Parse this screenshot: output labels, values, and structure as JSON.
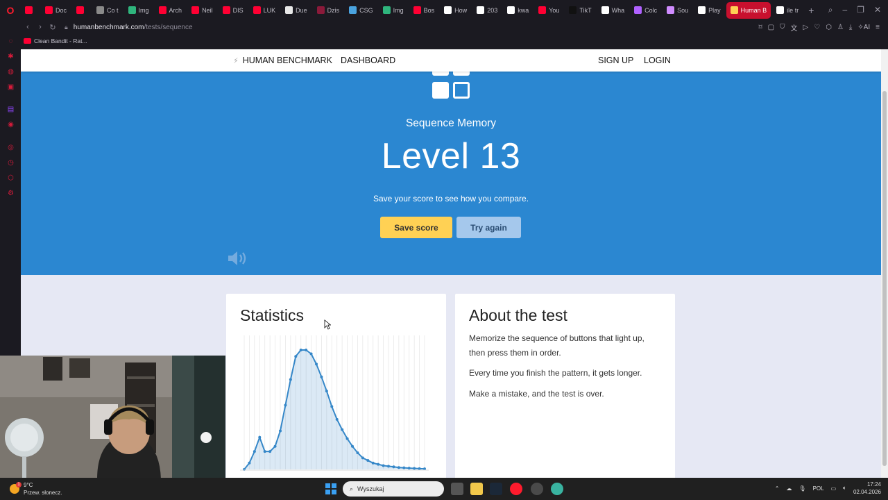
{
  "browser": {
    "tabs": [
      {
        "label": "",
        "color": "#ff0033"
      },
      {
        "label": "Doc",
        "color": "#ff0033"
      },
      {
        "label": "",
        "color": "#ff0033"
      },
      {
        "label": "Co t",
        "color": "#8a8a8a"
      },
      {
        "label": "Img",
        "color": "#2fb57d"
      },
      {
        "label": "Arch",
        "color": "#ff0033"
      },
      {
        "label": "Neil",
        "color": "#ff0033"
      },
      {
        "label": "DIS",
        "color": "#ff0033"
      },
      {
        "label": "LUK",
        "color": "#ff0033"
      },
      {
        "label": "Due",
        "color": "#e8e8e8"
      },
      {
        "label": "Dzis",
        "color": "#8b1a3a"
      },
      {
        "label": "CSG",
        "color": "#4aa3df"
      },
      {
        "label": "Img",
        "color": "#2fb57d"
      },
      {
        "label": "Bos",
        "color": "#ff0033"
      },
      {
        "label": "How",
        "color": "#ffffff"
      },
      {
        "label": "203",
        "color": "#ffffff"
      },
      {
        "label": "kwa",
        "color": "#ffffff"
      },
      {
        "label": "You",
        "color": "#ff0033"
      },
      {
        "label": "TikT",
        "color": "#111111"
      },
      {
        "label": "Wha",
        "color": "#ffffff"
      },
      {
        "label": "Colc",
        "color": "#b061ff"
      },
      {
        "label": "Sou",
        "color": "#d08cff"
      },
      {
        "label": "Play",
        "color": "#ffffff"
      },
      {
        "label": "Human B",
        "color": "#ffd154",
        "active": true
      },
      {
        "label": "ile tr",
        "color": "#ffffff"
      }
    ],
    "url_host": "humanbenchmark.com",
    "url_path": "/tests/sequence",
    "bookmark": "Clean Bandit - Rat..."
  },
  "site": {
    "brand": "HUMAN BENCHMARK",
    "dashboard": "DASHBOARD",
    "signup": "SIGN UP",
    "login": "LOGIN"
  },
  "hero": {
    "subtitle": "Sequence Memory",
    "title": "Level 13",
    "compare_text": "Save your score to see how you compare.",
    "save_button": "Save score",
    "try_button": "Try again"
  },
  "stats": {
    "title": "Statistics",
    "chart_data": {
      "type": "area",
      "values": [
        0,
        5,
        14,
        25,
        14,
        14,
        18,
        30,
        50,
        70,
        88,
        93,
        93,
        90,
        82,
        72,
        61,
        49,
        39,
        31,
        24,
        18,
        13,
        9,
        7,
        5,
        4,
        3,
        2.5,
        2,
        1.5,
        1.3,
        1,
        0.8,
        0.6,
        0.5
      ],
      "color": "#3587c8"
    }
  },
  "about": {
    "title": "About the test",
    "paragraphs": [
      "Memorize the sequence of buttons that light up, then press them in order.",
      "Every time you finish the pattern, it gets longer.",
      "Make a mistake, and the test is over."
    ]
  },
  "taskbar": {
    "temperature": "9°C",
    "weather": "Przew. słonecz.",
    "search_placeholder": "Wyszukaj",
    "lang": "POL",
    "time": "17:24",
    "date": "02.04.2026"
  }
}
